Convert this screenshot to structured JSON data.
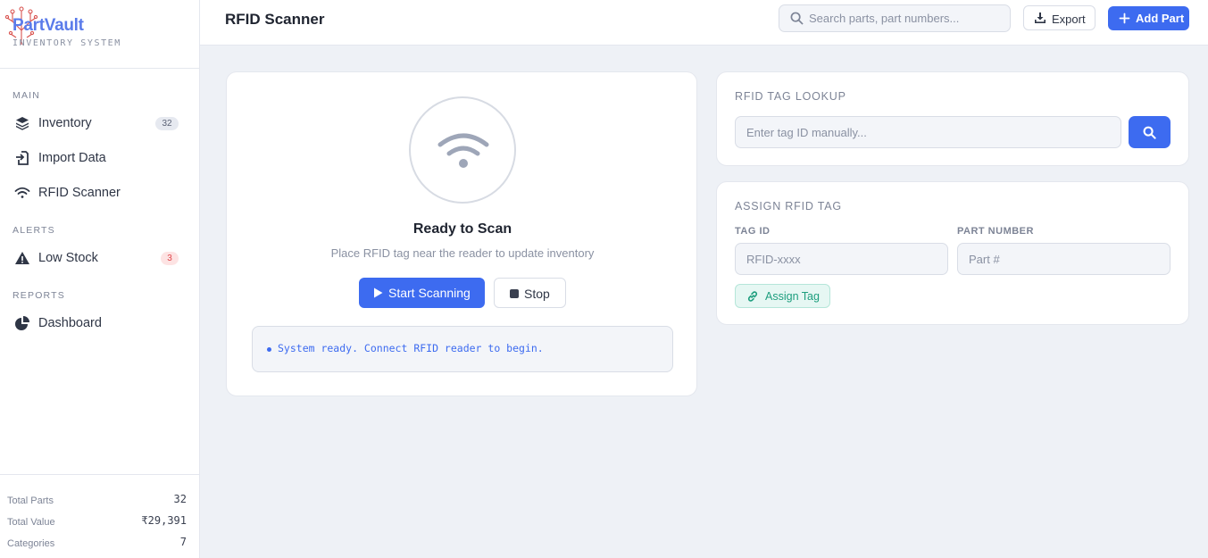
{
  "brand": {
    "name": "PartVault",
    "subtitle": "INVENTORY SYSTEM"
  },
  "sidebar": {
    "sections": [
      {
        "label": "MAIN"
      },
      {
        "label": "ALERTS"
      },
      {
        "label": "REPORTS"
      }
    ],
    "items": [
      {
        "label": "Inventory",
        "icon": "layers-icon",
        "badge": "32"
      },
      {
        "label": "Import Data",
        "icon": "import-icon"
      },
      {
        "label": "RFID Scanner",
        "icon": "wifi-icon"
      },
      {
        "label": "Low Stock",
        "icon": "warning-icon",
        "badge": "3"
      },
      {
        "label": "Dashboard",
        "icon": "pie-chart-icon"
      }
    ],
    "stats": [
      {
        "label": "Total Parts",
        "value": "32"
      },
      {
        "label": "Total Value",
        "value": "₹29,391"
      },
      {
        "label": "Categories",
        "value": "7"
      }
    ]
  },
  "topbar": {
    "title": "RFID Scanner",
    "search_placeholder": "Search parts, part numbers...",
    "export_label": "Export",
    "add_label": "Add Part"
  },
  "scanner": {
    "title": "Ready to Scan",
    "subtitle": "Place RFID tag near the reader to update inventory",
    "start_label": "Start Scanning",
    "stop_label": "Stop",
    "log_message": "System ready. Connect RFID reader to begin."
  },
  "lookup": {
    "title": "RFID TAG LOOKUP",
    "placeholder": "Enter tag ID manually..."
  },
  "assign": {
    "title": "ASSIGN RFID TAG",
    "tag_label": "TAG ID",
    "tag_placeholder": "RFID-xxxx",
    "part_label": "PART NUMBER",
    "part_placeholder": "Part #",
    "button_label": "Assign Tag"
  },
  "colors": {
    "accent": "#3d6bf0",
    "danger": "#e0474c",
    "success": "#1e9e7e",
    "background": "#eef1f6"
  }
}
